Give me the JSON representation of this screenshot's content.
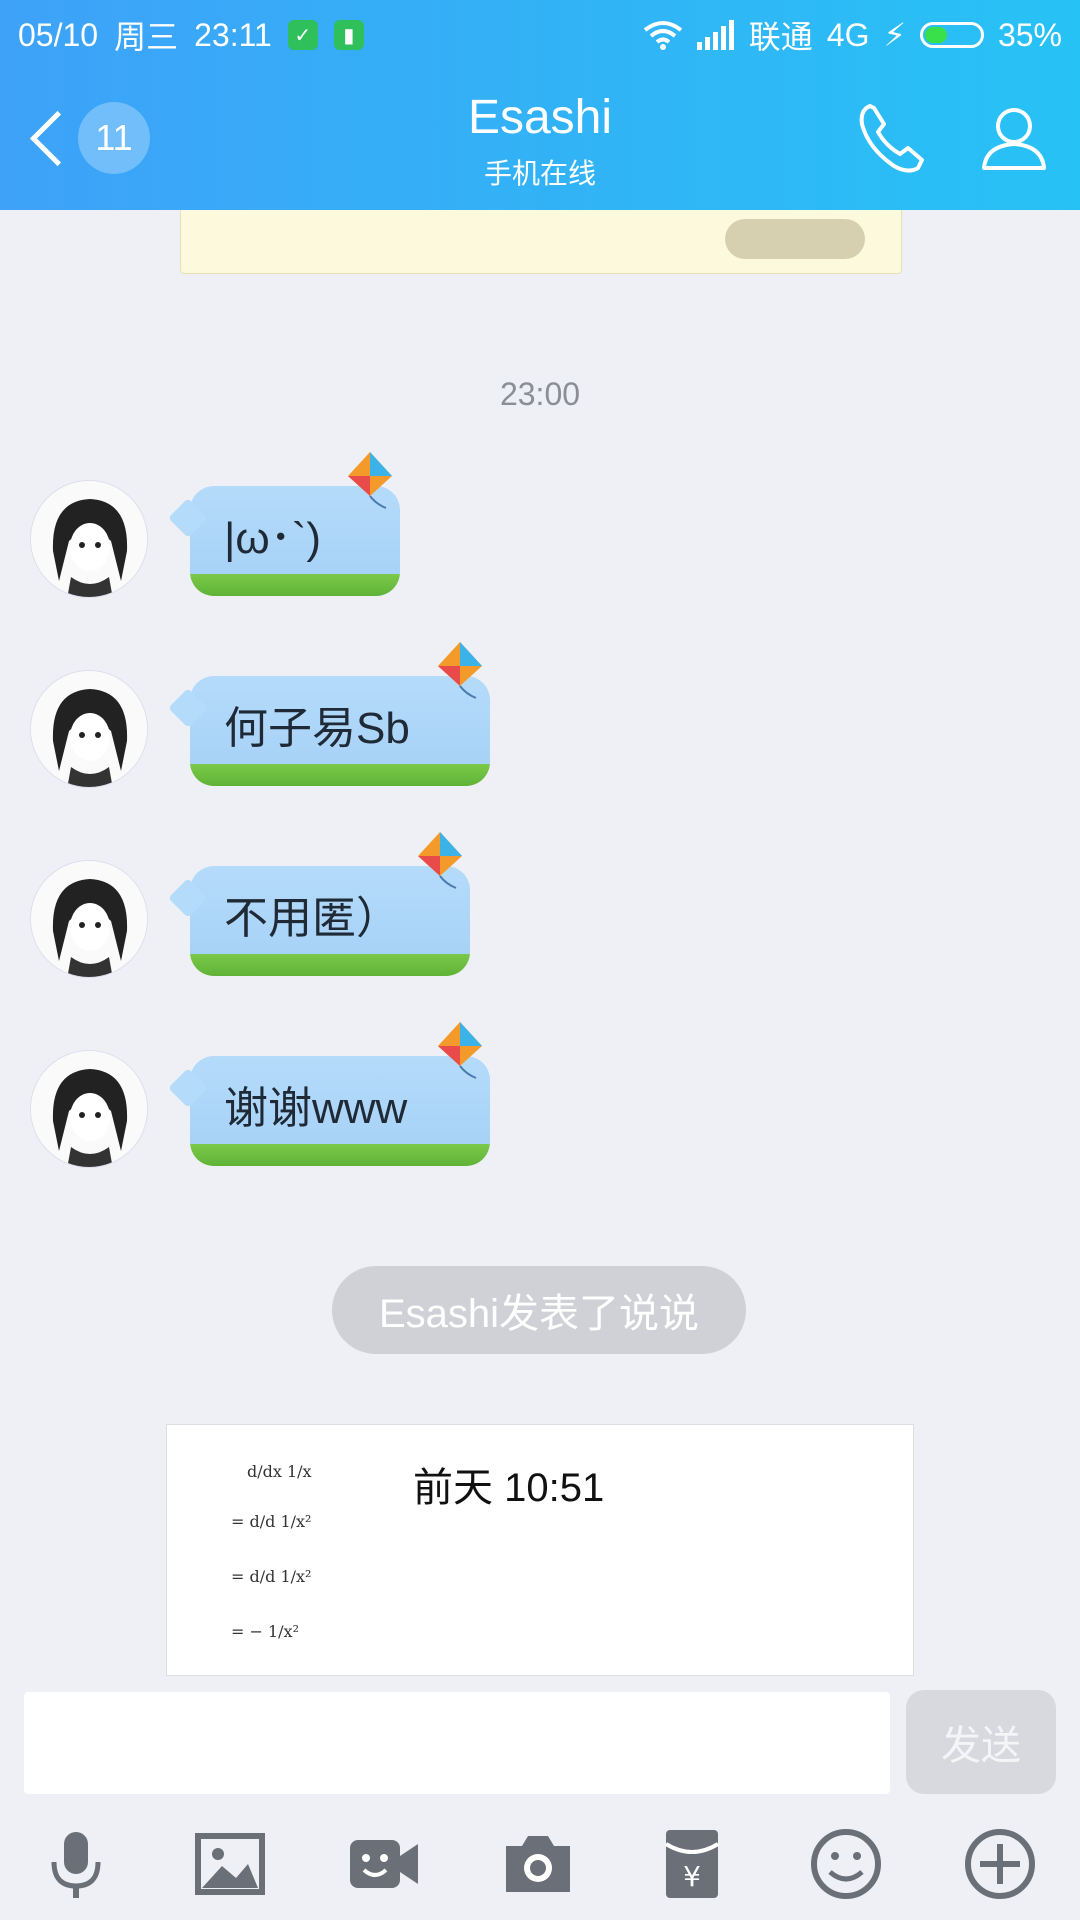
{
  "status_bar": {
    "date": "05/10",
    "weekday": "周三",
    "time": "23:11",
    "carrier": "联通",
    "network": "4G",
    "battery": "35%"
  },
  "header": {
    "back_badge": "11",
    "title": "Esashi",
    "subtitle": "手机在线",
    "accent_color": "#3ea2f8"
  },
  "chat": {
    "time_divider": "23:00",
    "messages": [
      {
        "text": "|ω･`)"
      },
      {
        "text": "何子易Sb"
      },
      {
        "text": "不用匿）"
      },
      {
        "text": "谢谢www"
      }
    ],
    "system_notice": "Esashi发表了说说",
    "share_card": {
      "timestamp": "前天 10:51",
      "thumb_lines": [
        "d/dx 1/x",
        "= d/d 1/x²",
        "= d/d 1/x²",
        "= − 1/x²"
      ]
    }
  },
  "input": {
    "send_label": "发送"
  },
  "toolbar": {
    "icons": [
      "microphone-icon",
      "image-icon",
      "video-call-icon",
      "camera-icon",
      "red-packet-icon",
      "emoji-icon",
      "plus-icon"
    ]
  }
}
